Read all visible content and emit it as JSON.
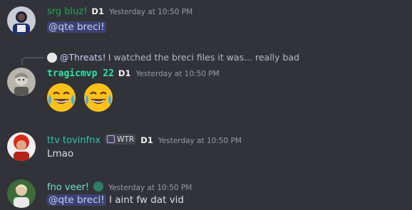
{
  "messages": [
    {
      "username": "srg bluz!",
      "username_color": "#23a55a",
      "tag": "D1",
      "timestamp": "Yesterday at 10:50 PM",
      "mention": "@qte breci!",
      "text": ""
    },
    {
      "reply": {
        "mention": "@Threats!",
        "text": "I watched the breci files it was... really bad"
      },
      "username": "tragicmvp 22",
      "username_color": "#2ee6a6",
      "tag": "D1",
      "timestamp": "Yesterday at 10:50 PM",
      "emojis": [
        "joy-emoji",
        "joy-emoji"
      ]
    },
    {
      "username": "ttv tovinfnx",
      "username_color": "#2dc7b1",
      "clan_tag": "WTR",
      "tag": "D1",
      "timestamp": "Yesterday at 10:50 PM",
      "text": "Lmao"
    },
    {
      "username": "fno veer!",
      "username_color": "#6ee2c9",
      "timestamp": "Yesterday at 10:50 PM",
      "mention": "@qte breci!",
      "text": "I aint fw dat vid"
    }
  ],
  "colors": {
    "background": "#313338",
    "mention_bg": "#3c4270",
    "mention_text": "#c9cdfb",
    "timestamp": "#949ba4"
  }
}
